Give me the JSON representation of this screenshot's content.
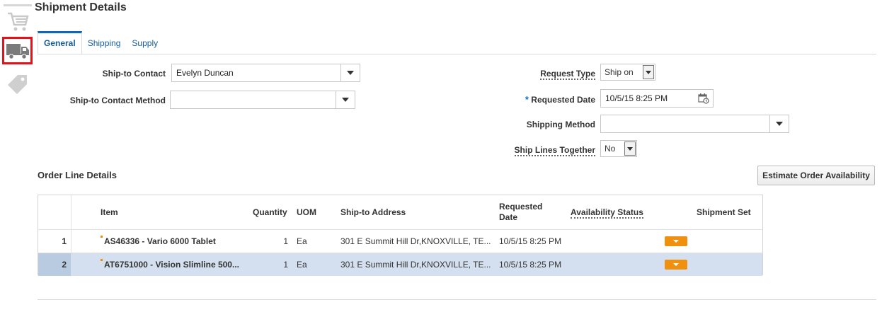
{
  "page": {
    "title": "Shipment Details"
  },
  "rail": {
    "icons": [
      "shopping-cart-icon",
      "truck-icon",
      "price-tag-icon"
    ],
    "active": "truck-icon",
    "active_color": "#e1141b"
  },
  "tabs": [
    {
      "label": "General",
      "active": true
    },
    {
      "label": "Shipping",
      "active": false
    },
    {
      "label": "Supply",
      "active": false
    }
  ],
  "form": {
    "ship_to_contact": {
      "label": "Ship-to Contact",
      "value": "Evelyn Duncan"
    },
    "ship_to_contact_method": {
      "label": "Ship-to Contact Method",
      "value": ""
    },
    "request_type": {
      "label": "Request Type",
      "value": "Ship on"
    },
    "requested_date": {
      "label": "Requested Date",
      "required_mark": "*",
      "value": "10/5/15 8:25 PM"
    },
    "shipping_method": {
      "label": "Shipping Method",
      "value": ""
    },
    "ship_lines_together": {
      "label": "Ship Lines Together",
      "value": "No"
    }
  },
  "order_lines": {
    "title": "Order Line Details",
    "estimate_button": "Estimate Order Availability",
    "columns": {
      "item": "Item",
      "quantity": "Quantity",
      "uom": "UOM",
      "ship_to_address": "Ship-to Address",
      "requested_date": "Requested Date",
      "availability_status": "Availability Status",
      "shipment_set": "Shipment Set"
    },
    "rows": [
      {
        "num": "1",
        "item": "AS46336 - Vario 6000 Tablet",
        "quantity": "1",
        "uom": "Ea",
        "address": "301 E Summit Hill Dr,KNOXVILLE, TE...",
        "requested_date": "10/5/15 8:25 PM",
        "availability_status": "",
        "shipment_set": "",
        "selected": false
      },
      {
        "num": "2",
        "item": "AT6751000 - Vision Slimline 500...",
        "quantity": "1",
        "uom": "Ea",
        "address": "301 E Summit Hill Dr,KNOXVILLE, TE...",
        "requested_date": "10/5/15 8:25 PM",
        "availability_status": "",
        "shipment_set": "",
        "selected": true
      }
    ]
  },
  "colors": {
    "accent": "#0e68b3",
    "orange": "#f0900f",
    "selected_row": "#d4e0ef"
  }
}
